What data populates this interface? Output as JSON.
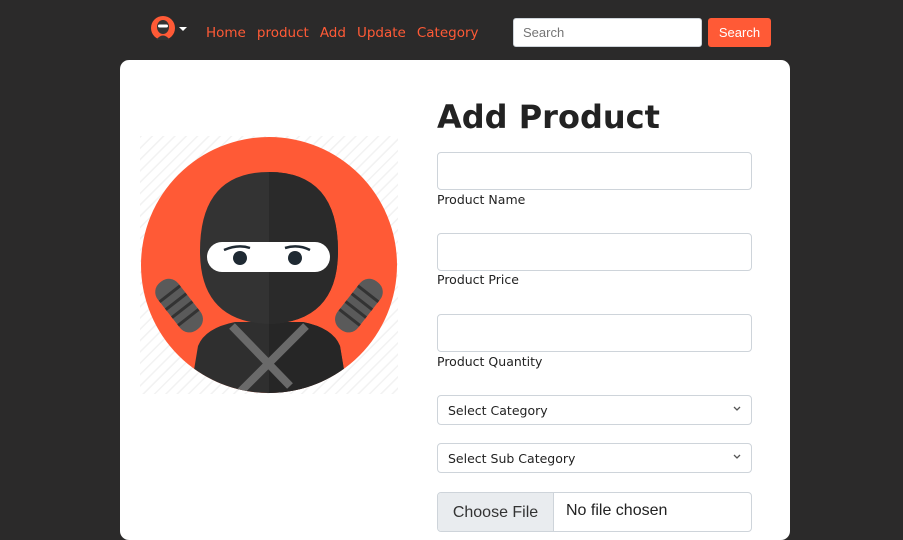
{
  "nav": {
    "links": [
      "Home",
      "product",
      "Add",
      "Update",
      "Category"
    ],
    "search_placeholder": "Search",
    "search_button": "Search"
  },
  "form": {
    "title": "Add Product",
    "fields": [
      {
        "label": "Product Name",
        "value": ""
      },
      {
        "label": "Product Price",
        "value": ""
      },
      {
        "label": "Product Quantity",
        "value": ""
      }
    ],
    "category_select": "Select Category",
    "subcategory_select": "Select Sub Category",
    "file_button": "Choose File",
    "file_status": "No file chosen"
  },
  "icons": {
    "logo": "ninja-logo-icon",
    "menu_caret": "caret-down-icon",
    "select_chevron": "chevron-down-icon"
  },
  "colors": {
    "accent": "#ff5a36",
    "background": "#2b2a2a",
    "card": "#ffffff"
  }
}
